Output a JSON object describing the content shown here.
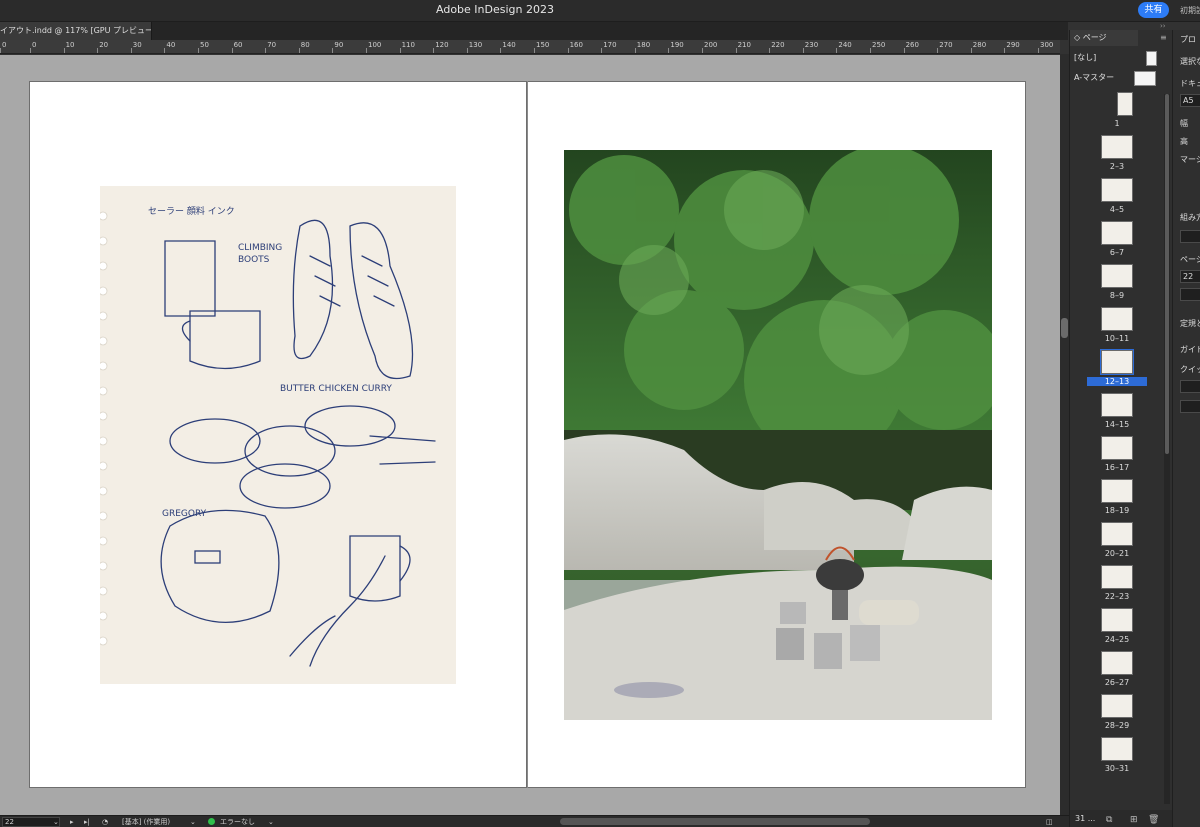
{
  "app": {
    "title": "Adobe InDesign 2023",
    "share_label": "共有",
    "reset_label": "初期設定"
  },
  "document": {
    "tab_label": "イアウト.indd @ 117% [GPU プレビュー]"
  },
  "ruler": {
    "labels": [
      "0",
      "0",
      "10",
      "20",
      "30",
      "40",
      "50",
      "60",
      "70",
      "80",
      "90",
      "100",
      "110",
      "120",
      "130",
      "140",
      "150",
      "160",
      "170",
      "180",
      "190",
      "200",
      "210",
      "220",
      "230",
      "240",
      "250",
      "260",
      "270",
      "280",
      "290",
      "300"
    ]
  },
  "pages_panel": {
    "tab_label": "◇ ページ",
    "menu_icon": "menu-icon",
    "none_label": "[なし]",
    "master_label": "A-マスター",
    "items": [
      {
        "label": "1",
        "selected": false
      },
      {
        "label": "2–3",
        "selected": false
      },
      {
        "label": "4–5",
        "selected": false
      },
      {
        "label": "6–7",
        "selected": false
      },
      {
        "label": "8–9",
        "selected": false
      },
      {
        "label": "10–11",
        "selected": false
      },
      {
        "label": "12–13",
        "selected": true
      },
      {
        "label": "14–15",
        "selected": false
      },
      {
        "label": "16–17",
        "selected": false
      },
      {
        "label": "18–19",
        "selected": false
      },
      {
        "label": "20–21",
        "selected": false
      },
      {
        "label": "22–23",
        "selected": false
      },
      {
        "label": "24–25",
        "selected": false
      },
      {
        "label": "26–27",
        "selected": false
      },
      {
        "label": "28–29",
        "selected": false
      },
      {
        "label": "30–31",
        "selected": false
      }
    ],
    "footer_count": "31 ..."
  },
  "properties_panel": {
    "title": "プロ",
    "selected_label": "選択な",
    "document_label": "ドキュ",
    "size_value": "A5",
    "width_label": "幅",
    "height_label": "高",
    "margin_label": "マージ",
    "layout_label": "組み方",
    "page_label": "ページ",
    "page_value": "22",
    "ruler_label": "定規と",
    "guide_label": "ガイド",
    "quick_label": "クイッ"
  },
  "statusbar": {
    "page_field": "22",
    "mode_label": "[基本] (作業用)",
    "preflight_label": "エラーなし",
    "colors": {
      "ok": "#2fbf4b"
    }
  },
  "sketch": {
    "text_1": "セーラー 顔料 インク",
    "text_2": "CLIMBING",
    "text_3": "BOOTS",
    "text_4": "BUTTER CHICKEN CURRY",
    "text_5": "GREGORY"
  },
  "colors": {
    "accent": "#2d7cf6",
    "selection": "#2d6bd6"
  }
}
